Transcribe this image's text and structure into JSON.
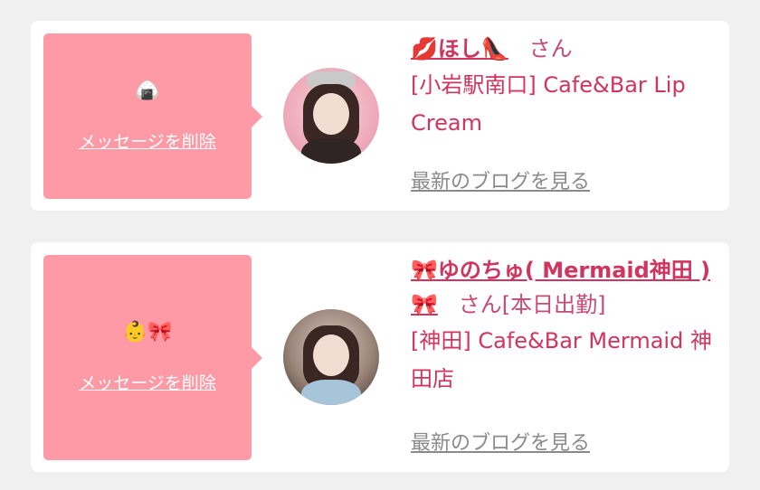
{
  "messages": [
    {
      "icons": "🍙",
      "delete_label": "メッセージを削除",
      "name": "💋ほし👠",
      "san": "さん",
      "status": "",
      "shop": "[小岩駅南口] Cafe&Bar Lip Cream",
      "blog_label": "最新のブログを見る"
    },
    {
      "icons": "👶🎀",
      "delete_label": "メッセージを削除",
      "name": "🎀ゆのちゅ( Mermaid神田 )🎀",
      "san": "さん",
      "status": "[本日出勤]",
      "shop": "[神田] Cafe&Bar Mermaid 神田店",
      "blog_label": "最新のブログを見る"
    }
  ],
  "colors": {
    "accent": "#d1345f",
    "message_box": "#fe9aa6",
    "muted_link": "#8a8a8a",
    "background": "#f0f0f0"
  }
}
